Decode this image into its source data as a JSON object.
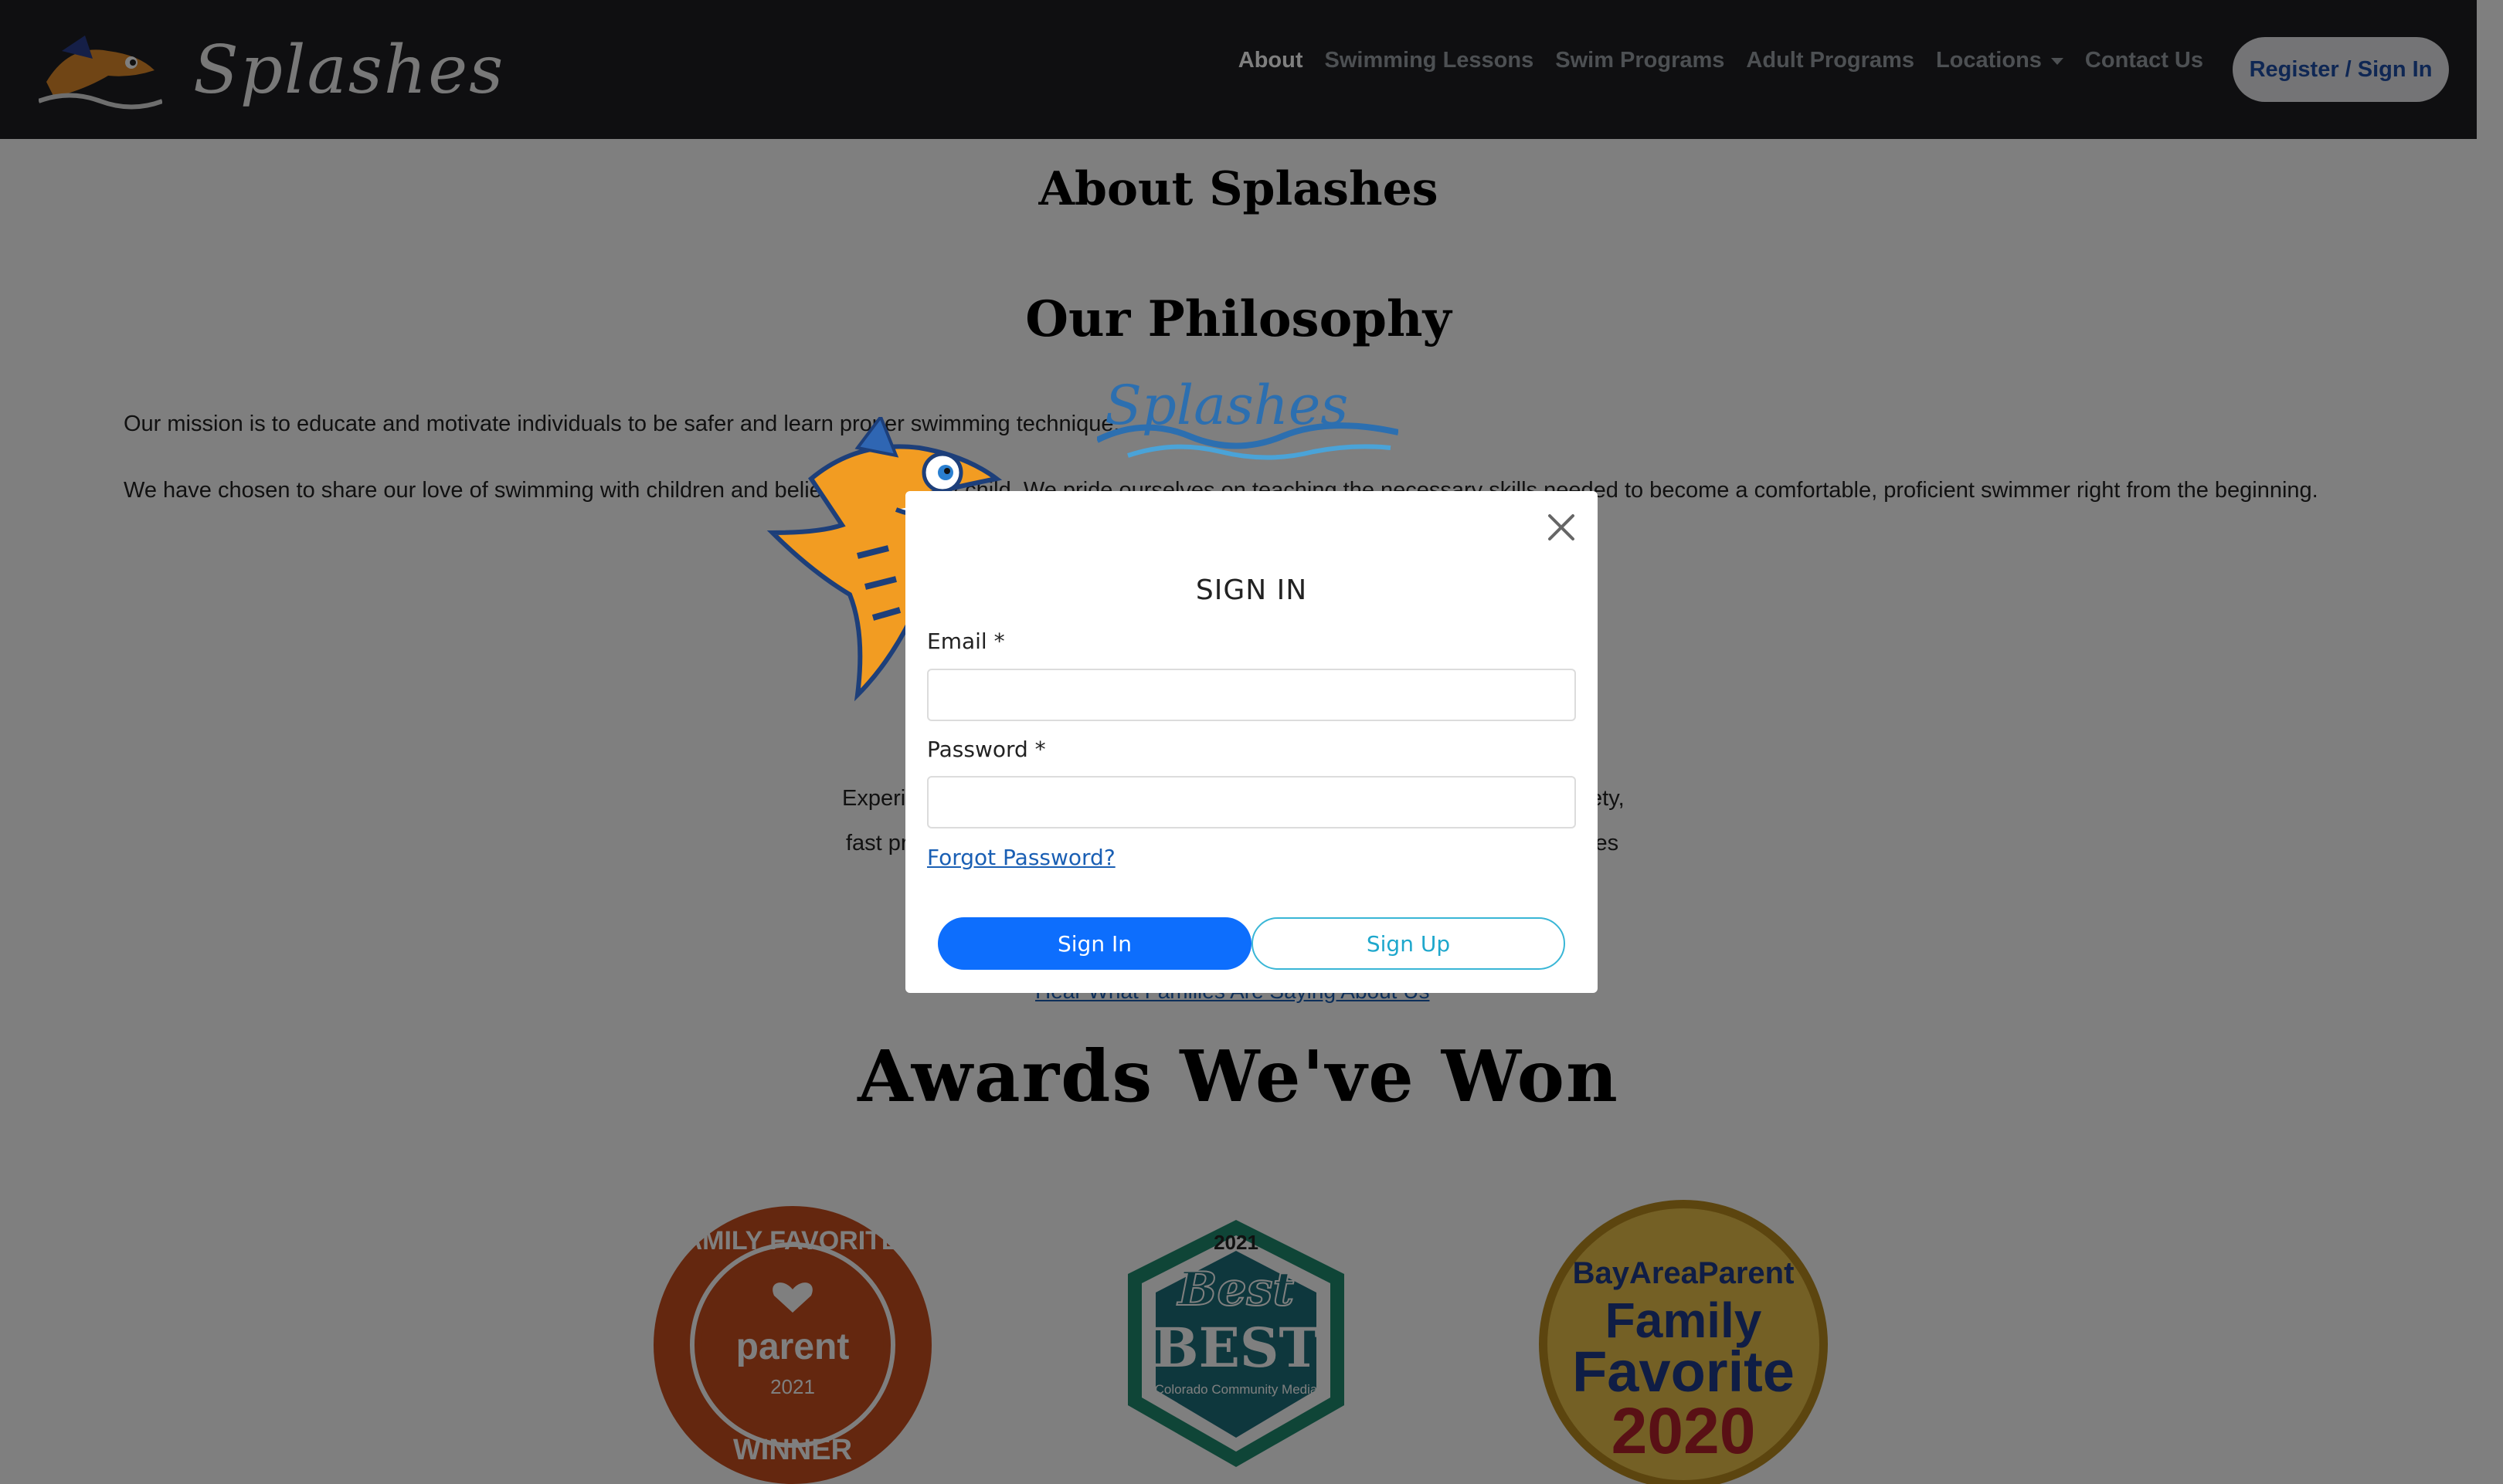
{
  "navbar": {
    "brand_name": "Splashes",
    "links": [
      "About",
      "Swimming Lessons",
      "Swim Programs",
      "Adult Programs",
      "Locations",
      "Contact Us"
    ],
    "active": "About",
    "register_label": "Register / Sign In"
  },
  "page": {
    "about_title": "About Splashes",
    "philosophy_title": "Our Philosophy",
    "mission_text": "Our mission is to educate and motivate individuals to be safer and learn proper swimming technique.",
    "share_text": "We have chosen to share our love of swimming with children and believe … in every child. We pride ourselves on teaching the necessary skills needed to become a comfortable, proficient swimmer right from the beginning.",
    "experience_line1_left": "Experi",
    "experience_line1_right": "fety,",
    "experience_line2_left": "fast pr",
    "experience_line2_right": "ves",
    "testimonial_link": "Hear What Families Are Saying About Us",
    "awards_title": "Awards We've Won"
  },
  "awards": [
    {
      "name": "Family Favorites Winner",
      "subtitle": "parent",
      "year": "2021",
      "color": "#c94f1e"
    },
    {
      "name": "Best of the Best",
      "subtitle": "Colorado Community Media",
      "year": "2021",
      "color": "#1f8a6e"
    },
    {
      "name": "BayAreaParent Family Favorite",
      "year": "2020",
      "color": "#d9a92b"
    }
  ],
  "modal": {
    "logo_text": "Splashes",
    "title": "SIGN IN",
    "email_label": "Email *",
    "email_value": "",
    "password_label": "Password *",
    "password_value": "",
    "forgot_label": "Forgot Password?",
    "signin_label": "Sign In",
    "signup_label": "Sign Up"
  },
  "colors": {
    "navbar_bg": "#1e1f22",
    "primary": "#0d6efd",
    "signup_border": "#39b6d6",
    "link": "#1a5fb4"
  }
}
